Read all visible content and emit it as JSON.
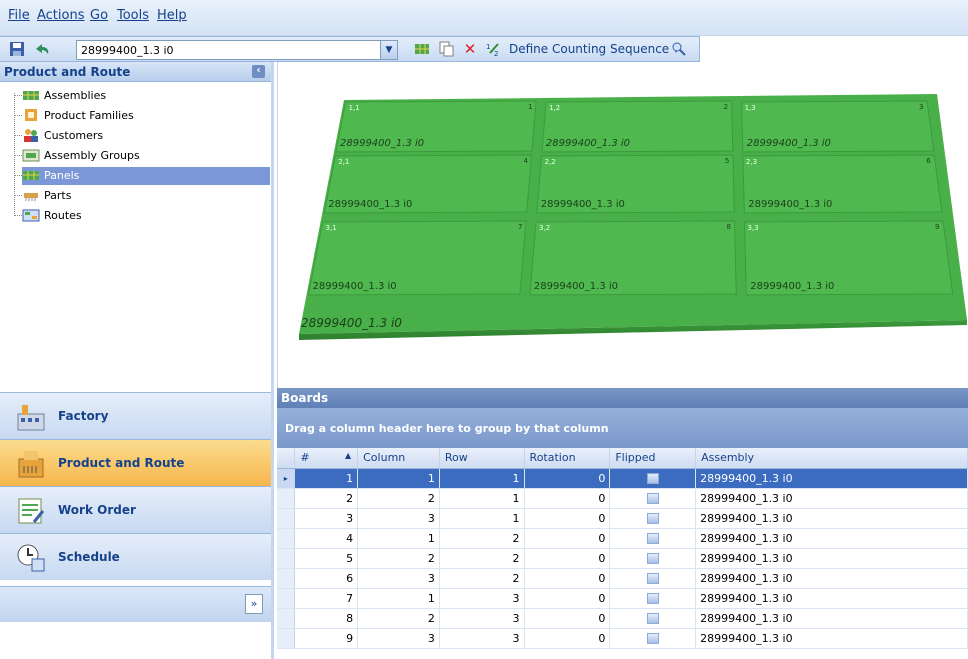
{
  "menu": [
    "File",
    "Actions",
    "Go",
    "Tools",
    "Help"
  ],
  "toolbar": {
    "combo_value": "28999400_1.3 i0",
    "define_label": "Define Counting Sequence ▾"
  },
  "left_panel": {
    "title": "Product and Route",
    "tree": [
      {
        "label": "Assemblies",
        "icon": "assembly-icon"
      },
      {
        "label": "Product Families",
        "icon": "product-families-icon"
      },
      {
        "label": "Customers",
        "icon": "customers-icon"
      },
      {
        "label": "Assembly Groups",
        "icon": "assembly-groups-icon"
      },
      {
        "label": "Panels",
        "icon": "panels-icon",
        "selected": true
      },
      {
        "label": "Parts",
        "icon": "parts-icon"
      },
      {
        "label": "Routes",
        "icon": "routes-icon"
      }
    ],
    "nav": [
      {
        "label": "Factory",
        "icon": "factory-icon"
      },
      {
        "label": "Product and Route",
        "icon": "product-route-icon",
        "active": true
      },
      {
        "label": "Work Order",
        "icon": "work-order-icon"
      },
      {
        "label": "Schedule",
        "icon": "schedule-icon"
      }
    ]
  },
  "viewer": {
    "boards": [
      {
        "pos": "1,1",
        "num": "1",
        "label": "28999400_1.3 i0"
      },
      {
        "pos": "1,2",
        "num": "2",
        "label": "28999400_1.3 i0"
      },
      {
        "pos": "1,3",
        "num": "3",
        "label": "28999400_1.3 i0"
      },
      {
        "pos": "2,1",
        "num": "4",
        "label": "28999400_1.3 i0"
      },
      {
        "pos": "2,2",
        "num": "5",
        "label": "28999400_1.3 i0"
      },
      {
        "pos": "2,3",
        "num": "6",
        "label": "28999400_1.3 i0"
      },
      {
        "pos": "3,1",
        "num": "7",
        "label": "28999400_1.3 i0"
      },
      {
        "pos": "3,2",
        "num": "8",
        "label": "28999400_1.3 i0"
      },
      {
        "pos": "3,3",
        "num": "9",
        "label": "28999400_1.3 i0"
      }
    ],
    "panel_label": "28999400_1.3 i0",
    "board_color": "#4fb84f"
  },
  "boards_section": {
    "title": "Boards",
    "group_hint": "Drag a column header here to group by that column",
    "columns": [
      "#",
      "Column",
      "Row",
      "Rotation",
      "Flipped",
      "Assembly"
    ],
    "rows": [
      [
        "1",
        "1",
        "1",
        "0",
        "28999400_1.3 i0"
      ],
      [
        "2",
        "2",
        "1",
        "0",
        "28999400_1.3 i0"
      ],
      [
        "3",
        "3",
        "1",
        "0",
        "28999400_1.3 i0"
      ],
      [
        "4",
        "1",
        "2",
        "0",
        "28999400_1.3 i0"
      ],
      [
        "5",
        "2",
        "2",
        "0",
        "28999400_1.3 i0"
      ],
      [
        "6",
        "3",
        "2",
        "0",
        "28999400_1.3 i0"
      ],
      [
        "7",
        "1",
        "3",
        "0",
        "28999400_1.3 i0"
      ],
      [
        "8",
        "2",
        "3",
        "0",
        "28999400_1.3 i0"
      ],
      [
        "9",
        "3",
        "3",
        "0",
        "28999400_1.3 i0"
      ]
    ]
  }
}
